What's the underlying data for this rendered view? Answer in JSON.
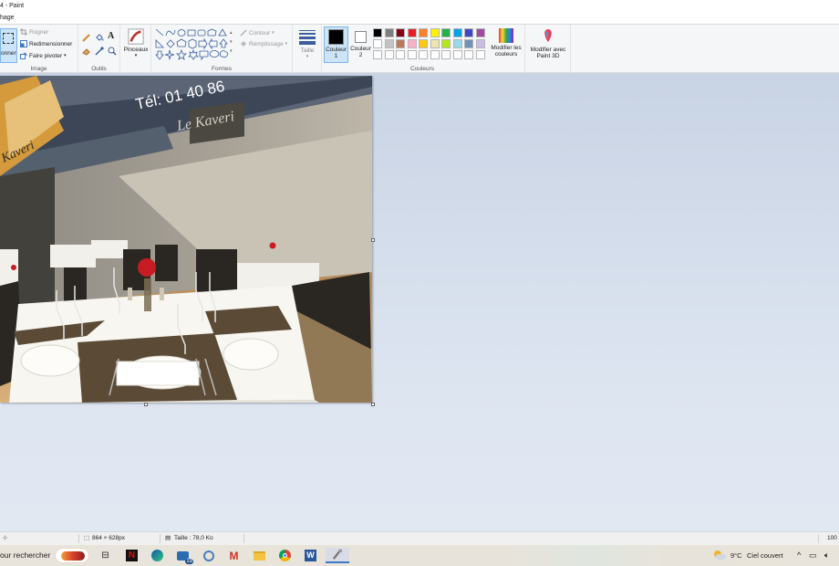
{
  "window": {
    "title": "4 - Paint"
  },
  "menu": {
    "view_tab": "hage"
  },
  "ribbon": {
    "image_group": {
      "label": "Image",
      "select_partial": "onner",
      "crop": "Rogner",
      "resize": "Redimensionner",
      "rotate": "Faire pivoter"
    },
    "tools_group": {
      "label": "Outils"
    },
    "brushes": {
      "label": "Pinceaux"
    },
    "shapes_group": {
      "label": "Formes",
      "outline": "Contour",
      "fill": "Remplissage"
    },
    "size": {
      "label": "Taille"
    },
    "color1": {
      "label": "Couleur",
      "num": "1",
      "value": "#000000"
    },
    "color2": {
      "label": "Couleur",
      "num": "2",
      "value": "#ffffff"
    },
    "colors_group": {
      "label": "Couleurs",
      "palette_row1": [
        "#000000",
        "#7f7f7f",
        "#880015",
        "#ed1c24",
        "#ff7f27",
        "#fff200",
        "#22b14c",
        "#00a2e8",
        "#3f48cc",
        "#a349a4"
      ],
      "palette_row2": [
        "#ffffff",
        "#c3c3c3",
        "#b97a57",
        "#ffaec9",
        "#ffc90e",
        "#efe4b0",
        "#b5e61d",
        "#99d9ea",
        "#7092be",
        "#c8bfe7"
      ],
      "palette_row3": [
        "#ffffff",
        "#ffffff",
        "#ffffff",
        "#ffffff",
        "#ffffff",
        "#ffffff",
        "#ffffff",
        "#ffffff",
        "#ffffff",
        "#ffffff"
      ]
    },
    "edit_colors": {
      "line1": "Modifier les",
      "line2": "couleurs"
    },
    "paint3d": {
      "line1": "Modifier avec",
      "line2": "Paint 3D"
    }
  },
  "image": {
    "sign_phone": "Tél: 01 40 86",
    "sign_name": "Le Kaveri",
    "awning_text": "Kaveri"
  },
  "status": {
    "dimensions": "864 × 628px",
    "size": "Taille : 78,0 Ko",
    "zoom": "100"
  },
  "taskbar": {
    "search": "our rechercher",
    "weather_temp": "9°C",
    "weather_text": "Ciel couvert",
    "mail_badge": "19"
  }
}
